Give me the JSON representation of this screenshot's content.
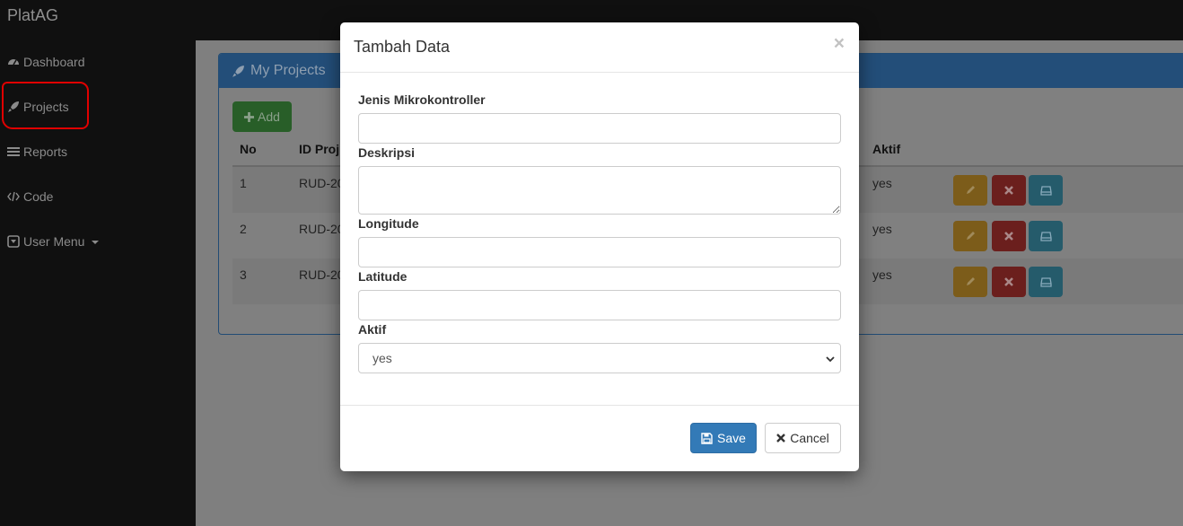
{
  "app": {
    "brand": "PlatAG"
  },
  "sidebar": {
    "items": [
      {
        "label": "Dashboard",
        "icon": "dashboard-icon"
      },
      {
        "label": "Projects",
        "icon": "rocket-icon"
      },
      {
        "label": "Reports",
        "icon": "list-icon"
      },
      {
        "label": "Code",
        "icon": "code-icon"
      },
      {
        "label": "User Menu",
        "icon": "user-menu-icon"
      }
    ]
  },
  "panel": {
    "title": "My Projects",
    "add_label": "Add",
    "columns": [
      "No",
      "ID Proj",
      "Aktif"
    ],
    "rows": [
      {
        "no": "1",
        "id": "RUD-20",
        "aktif": "yes"
      },
      {
        "no": "2",
        "id": "RUD-20",
        "aktif": "yes"
      },
      {
        "no": "3",
        "id": "RUD-20",
        "aktif": "yes"
      }
    ]
  },
  "modal": {
    "title": "Tambah Data",
    "close": "×",
    "fields": {
      "jenis": {
        "label": "Jenis Mikrokontroller",
        "value": ""
      },
      "deskripsi": {
        "label": "Deskripsi",
        "value": ""
      },
      "longitude": {
        "label": "Longitude",
        "value": ""
      },
      "latitude": {
        "label": "Latitude",
        "value": ""
      },
      "aktif": {
        "label": "Aktif",
        "value": "yes"
      }
    },
    "save_label": "Save",
    "cancel_label": "Cancel"
  },
  "colors": {
    "primary": "#337ab7",
    "annotation": "#e00000",
    "warning": "#f0ad4e",
    "danger": "#d9534f",
    "info": "#5bc0de"
  }
}
